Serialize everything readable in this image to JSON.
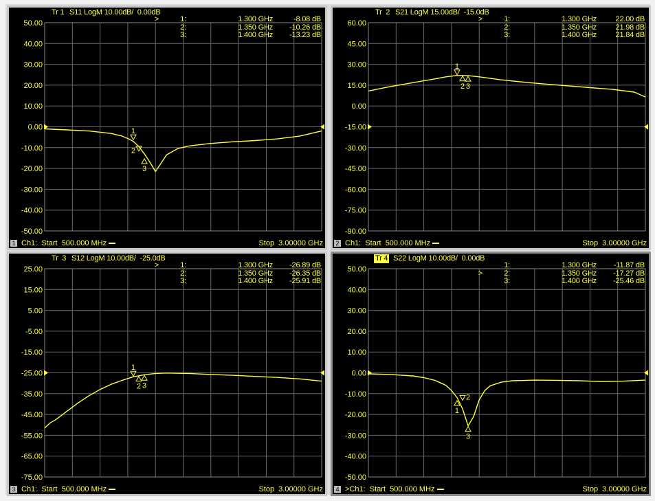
{
  "colors": {
    "trace": "#ffff40",
    "grid": "#6a6a6a",
    "background": "#000000",
    "frame": "#c8c8c8"
  },
  "chart_data": [
    {
      "type": "line",
      "header": {
        "trace": "Tr 1",
        "text": "S11 LogM 10.00dB/  0.00dB",
        "selected": false
      },
      "y_ticks": [
        "50.00",
        "40.00",
        "30.00",
        "20.00",
        "10.00",
        "0.00",
        "-10.00",
        "-20.00",
        "-30.00",
        "-40.00",
        "-50.00"
      ],
      "ylim": [
        -50,
        50
      ],
      "xlim": [
        0.5,
        3.0
      ],
      "reference_level": 0,
      "markers_table": [
        {
          "sel": ">",
          "num": "1:",
          "freq": "1.300 GHz",
          "value": "-8.08 dB"
        },
        {
          "sel": "",
          "num": "2:",
          "freq": "1.350 GHz",
          "value": "-10.26 dB"
        },
        {
          "sel": "",
          "num": "3:",
          "freq": "1.400 GHz",
          "value": "-13.23 dB"
        }
      ],
      "series": [
        {
          "x": [
            0.5,
            0.7,
            0.9,
            1.1,
            1.2,
            1.25,
            1.3,
            1.35,
            1.4,
            1.45,
            1.5,
            1.55,
            1.6,
            1.7,
            1.8,
            2.0,
            2.2,
            2.4,
            2.6,
            2.8,
            3.0
          ],
          "y": [
            -1.0,
            -1.5,
            -2.0,
            -3.2,
            -4.5,
            -5.6,
            -7.0,
            -9.5,
            -13.0,
            -17.0,
            -21.5,
            -17.5,
            -13.5,
            -10.5,
            -9.2,
            -8.0,
            -7.2,
            -6.6,
            -5.8,
            -4.5,
            -2.0
          ]
        }
      ],
      "markers": [
        {
          "label": "1",
          "x": 1.3,
          "y": -6.5,
          "pos": "above"
        },
        {
          "label": "2",
          "x": 1.35,
          "y": -12,
          "pos": "left"
        },
        {
          "label": "3",
          "x": 1.4,
          "y": -15,
          "pos": "below"
        }
      ],
      "footer": {
        "channel_num": "1",
        "start": "Ch1:  Start  500.000 MHz",
        "stop": "Stop  3.00000 GHz"
      }
    },
    {
      "type": "line",
      "header": {
        "trace": "Tr  2",
        "text": "S21 LogM 15.00dB/  -15.0dB",
        "selected": false
      },
      "y_ticks": [
        "60.00",
        "45.00",
        "30.00",
        "15.00",
        "0.00",
        "-15.00",
        "-30.00",
        "-45.00",
        "-60.00",
        "-75.00",
        "-90.00"
      ],
      "ylim": [
        -90,
        60
      ],
      "xlim": [
        0.5,
        3.0
      ],
      "reference_level": -15,
      "markers_table": [
        {
          "sel": ">",
          "num": "1:",
          "freq": "1.300 GHz",
          "value": "22.00 dB"
        },
        {
          "sel": "",
          "num": "2:",
          "freq": "1.350 GHz",
          "value": "21.98 dB"
        },
        {
          "sel": "",
          "num": "3:",
          "freq": "1.400 GHz",
          "value": "21.84 dB"
        }
      ],
      "series": [
        {
          "x": [
            0.5,
            0.7,
            0.9,
            1.1,
            1.2,
            1.3,
            1.35,
            1.4,
            1.5,
            1.7,
            1.9,
            2.1,
            2.3,
            2.5,
            2.7,
            2.9,
            3.0
          ],
          "y": [
            10.8,
            14.0,
            16.8,
            19.5,
            21.0,
            22.0,
            21.98,
            21.84,
            21.0,
            18.8,
            17.2,
            15.8,
            14.5,
            13.2,
            12.0,
            10.0,
            6.5
          ]
        }
      ],
      "markers": [
        {
          "label": "1",
          "x": 1.3,
          "y": 22,
          "pos": "above"
        },
        {
          "label": "2",
          "x": 1.35,
          "y": 21.98,
          "pos": "below"
        },
        {
          "label": "3",
          "x": 1.4,
          "y": 21.84,
          "pos": "below"
        }
      ],
      "footer": {
        "channel_num": "2",
        "start": "Ch1:  Start  500.000 MHz",
        "stop": "Stop  3.00000 GHz"
      }
    },
    {
      "type": "line",
      "header": {
        "trace": "Tr  3",
        "text": "S12 LogM 10.00dB/  -25.0dB",
        "selected": false
      },
      "y_ticks": [
        "25.00",
        "15.00",
        "5.00",
        "-5.00",
        "-15.00",
        "-25.00",
        "-35.00",
        "-45.00",
        "-55.00",
        "-65.00",
        "-75.00"
      ],
      "ylim": [
        -75,
        25
      ],
      "xlim": [
        0.5,
        3.0
      ],
      "reference_level": -25,
      "markers_table": [
        {
          "sel": ">",
          "num": "1:",
          "freq": "1.300 GHz",
          "value": "-26.89 dB"
        },
        {
          "sel": "",
          "num": "2:",
          "freq": "1.350 GHz",
          "value": "-26.35 dB"
        },
        {
          "sel": "",
          "num": "3:",
          "freq": "1.400 GHz",
          "value": "-25.91 dB"
        }
      ],
      "series": [
        {
          "x": [
            0.5,
            0.55,
            0.6,
            0.7,
            0.8,
            0.9,
            1.0,
            1.1,
            1.2,
            1.3,
            1.4,
            1.5,
            1.6,
            1.8,
            2.0,
            2.2,
            2.4,
            2.6,
            2.8,
            3.0
          ],
          "y": [
            -51.5,
            -49,
            -47.5,
            -43.5,
            -39.5,
            -36,
            -33,
            -30.5,
            -28.6,
            -26.89,
            -25.91,
            -25.3,
            -25.1,
            -25.3,
            -25.8,
            -26.2,
            -26.7,
            -27.2,
            -27.9,
            -29.0
          ]
        }
      ],
      "markers": [
        {
          "label": "1",
          "x": 1.3,
          "y": -26.89,
          "pos": "above"
        },
        {
          "label": "2",
          "x": 1.35,
          "y": -26.35,
          "pos": "below"
        },
        {
          "label": "3",
          "x": 1.4,
          "y": -25.91,
          "pos": "below"
        }
      ],
      "footer": {
        "channel_num": "3",
        "start": "Ch1:  Start  500.000 MHz",
        "stop": "Stop  3.00000 GHz"
      }
    },
    {
      "type": "line",
      "header": {
        "trace": "Tr 4",
        "text": "S22 LogM 10.00dB/  0.00dB",
        "selected": true
      },
      "y_ticks": [
        "50.00",
        "40.00",
        "30.00",
        "20.00",
        "10.00",
        "0.00",
        "-10.00",
        "-20.00",
        "-30.00",
        "-40.00",
        "-50.00"
      ],
      "ylim": [
        -50,
        50
      ],
      "xlim": [
        0.5,
        3.0
      ],
      "reference_level": 0,
      "markers_table": [
        {
          "sel": "",
          "num": "1:",
          "freq": "1.300 GHz",
          "value": "-11.87 dB"
        },
        {
          "sel": ">",
          "num": "2:",
          "freq": "1.350 GHz",
          "value": "-17.27 dB"
        },
        {
          "sel": "",
          "num": "3:",
          "freq": "1.400 GHz",
          "value": "-25.46 dB"
        }
      ],
      "series": [
        {
          "x": [
            0.5,
            0.7,
            0.9,
            1.0,
            1.1,
            1.2,
            1.25,
            1.3,
            1.35,
            1.4,
            1.45,
            1.5,
            1.55,
            1.6,
            1.7,
            1.8,
            2.0,
            2.2,
            2.4,
            2.6,
            2.8,
            3.0
          ],
          "y": [
            -0.5,
            -0.8,
            -1.5,
            -2.3,
            -3.6,
            -6.0,
            -8.5,
            -11.87,
            -17.27,
            -25.46,
            -21.0,
            -13.0,
            -8.5,
            -6.2,
            -4.5,
            -3.8,
            -3.5,
            -3.6,
            -3.8,
            -4.2,
            -4.0,
            -3.5
          ]
        }
      ],
      "markers": [
        {
          "label": "1",
          "x": 1.3,
          "y": -13,
          "pos": "below"
        },
        {
          "label": "2",
          "x": 1.35,
          "y": -13.5,
          "pos": "right"
        },
        {
          "label": "3",
          "x": 1.4,
          "y": -25.46,
          "pos": "below"
        }
      ],
      "footer": {
        "channel_num": "4",
        "start": ">Ch1:  Start  500.000 MHz",
        "stop": "Stop  3.00000 GHz"
      }
    }
  ]
}
